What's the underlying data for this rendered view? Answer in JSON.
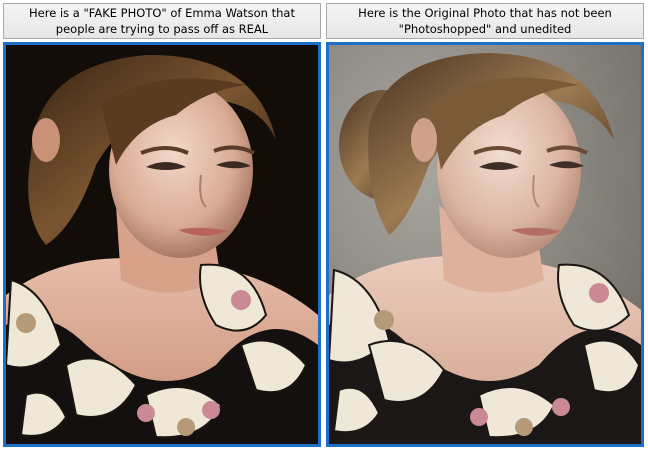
{
  "panels": [
    {
      "caption_line1": "Here is a \"FAKE PHOTO\" of Emma Watson that",
      "caption_line2": "people are trying to pass off as REAL",
      "photo": "fake-photo-dark-background",
      "background_color": "#120d08"
    },
    {
      "caption_line1": "Here is the Original Photo that has not been",
      "caption_line2": "\"Photoshopped\" and unedited",
      "photo": "original-photo-gray-background",
      "background_color": "#8f8b86"
    }
  ],
  "colors": {
    "frame_border": "#1d6fc8",
    "caption_border": "#a9a9a9"
  }
}
